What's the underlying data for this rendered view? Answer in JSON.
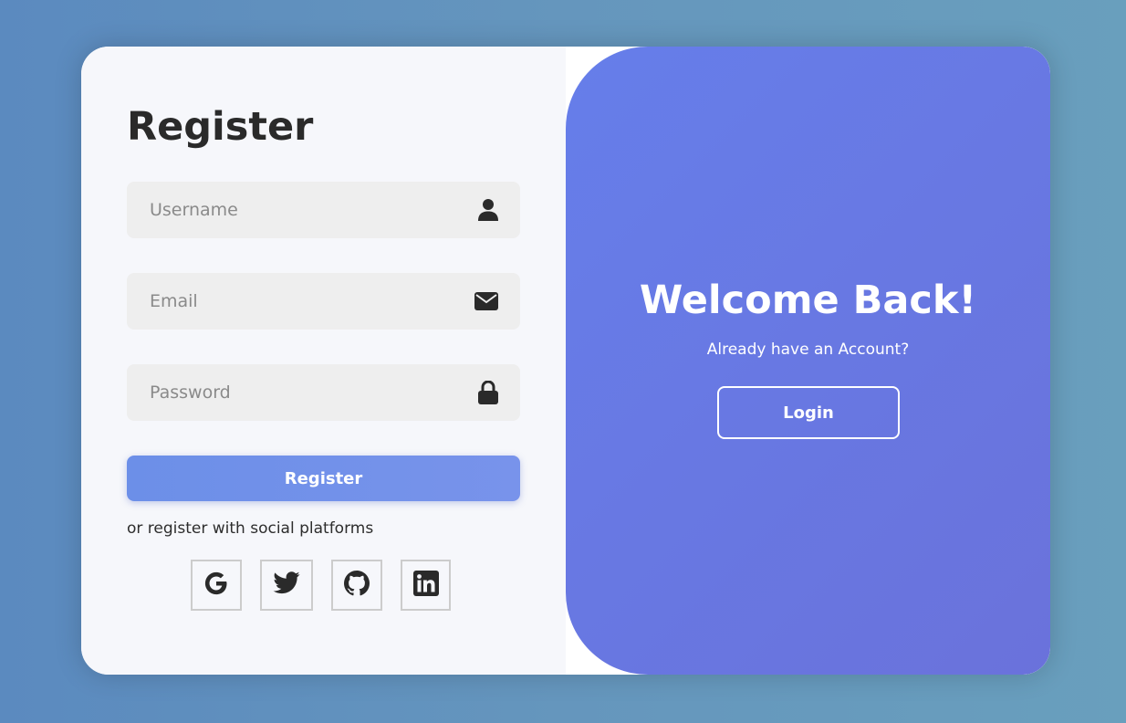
{
  "register": {
    "title": "Register",
    "fields": {
      "username": {
        "placeholder": "Username",
        "value": "",
        "icon": "user-icon"
      },
      "email": {
        "placeholder": "Email",
        "value": "",
        "icon": "envelope-icon"
      },
      "password": {
        "placeholder": "Password",
        "value": "",
        "icon": "lock-icon"
      }
    },
    "submit_label": "Register",
    "social_text": "or register with social platforms",
    "social_icons": [
      "google-icon",
      "twitter-icon",
      "github-icon",
      "linkedin-icon"
    ]
  },
  "welcome": {
    "title": "Welcome Back!",
    "subtitle": "Already have an Account?",
    "login_label": "Login"
  },
  "colors": {
    "background": "#6596bd",
    "panel_gradient_start": "#667eea",
    "panel_gradient_end": "#6a72db",
    "register_button": "#7291ea",
    "text_dark": "#2a2a2a",
    "field_bg": "#eeeeee"
  }
}
